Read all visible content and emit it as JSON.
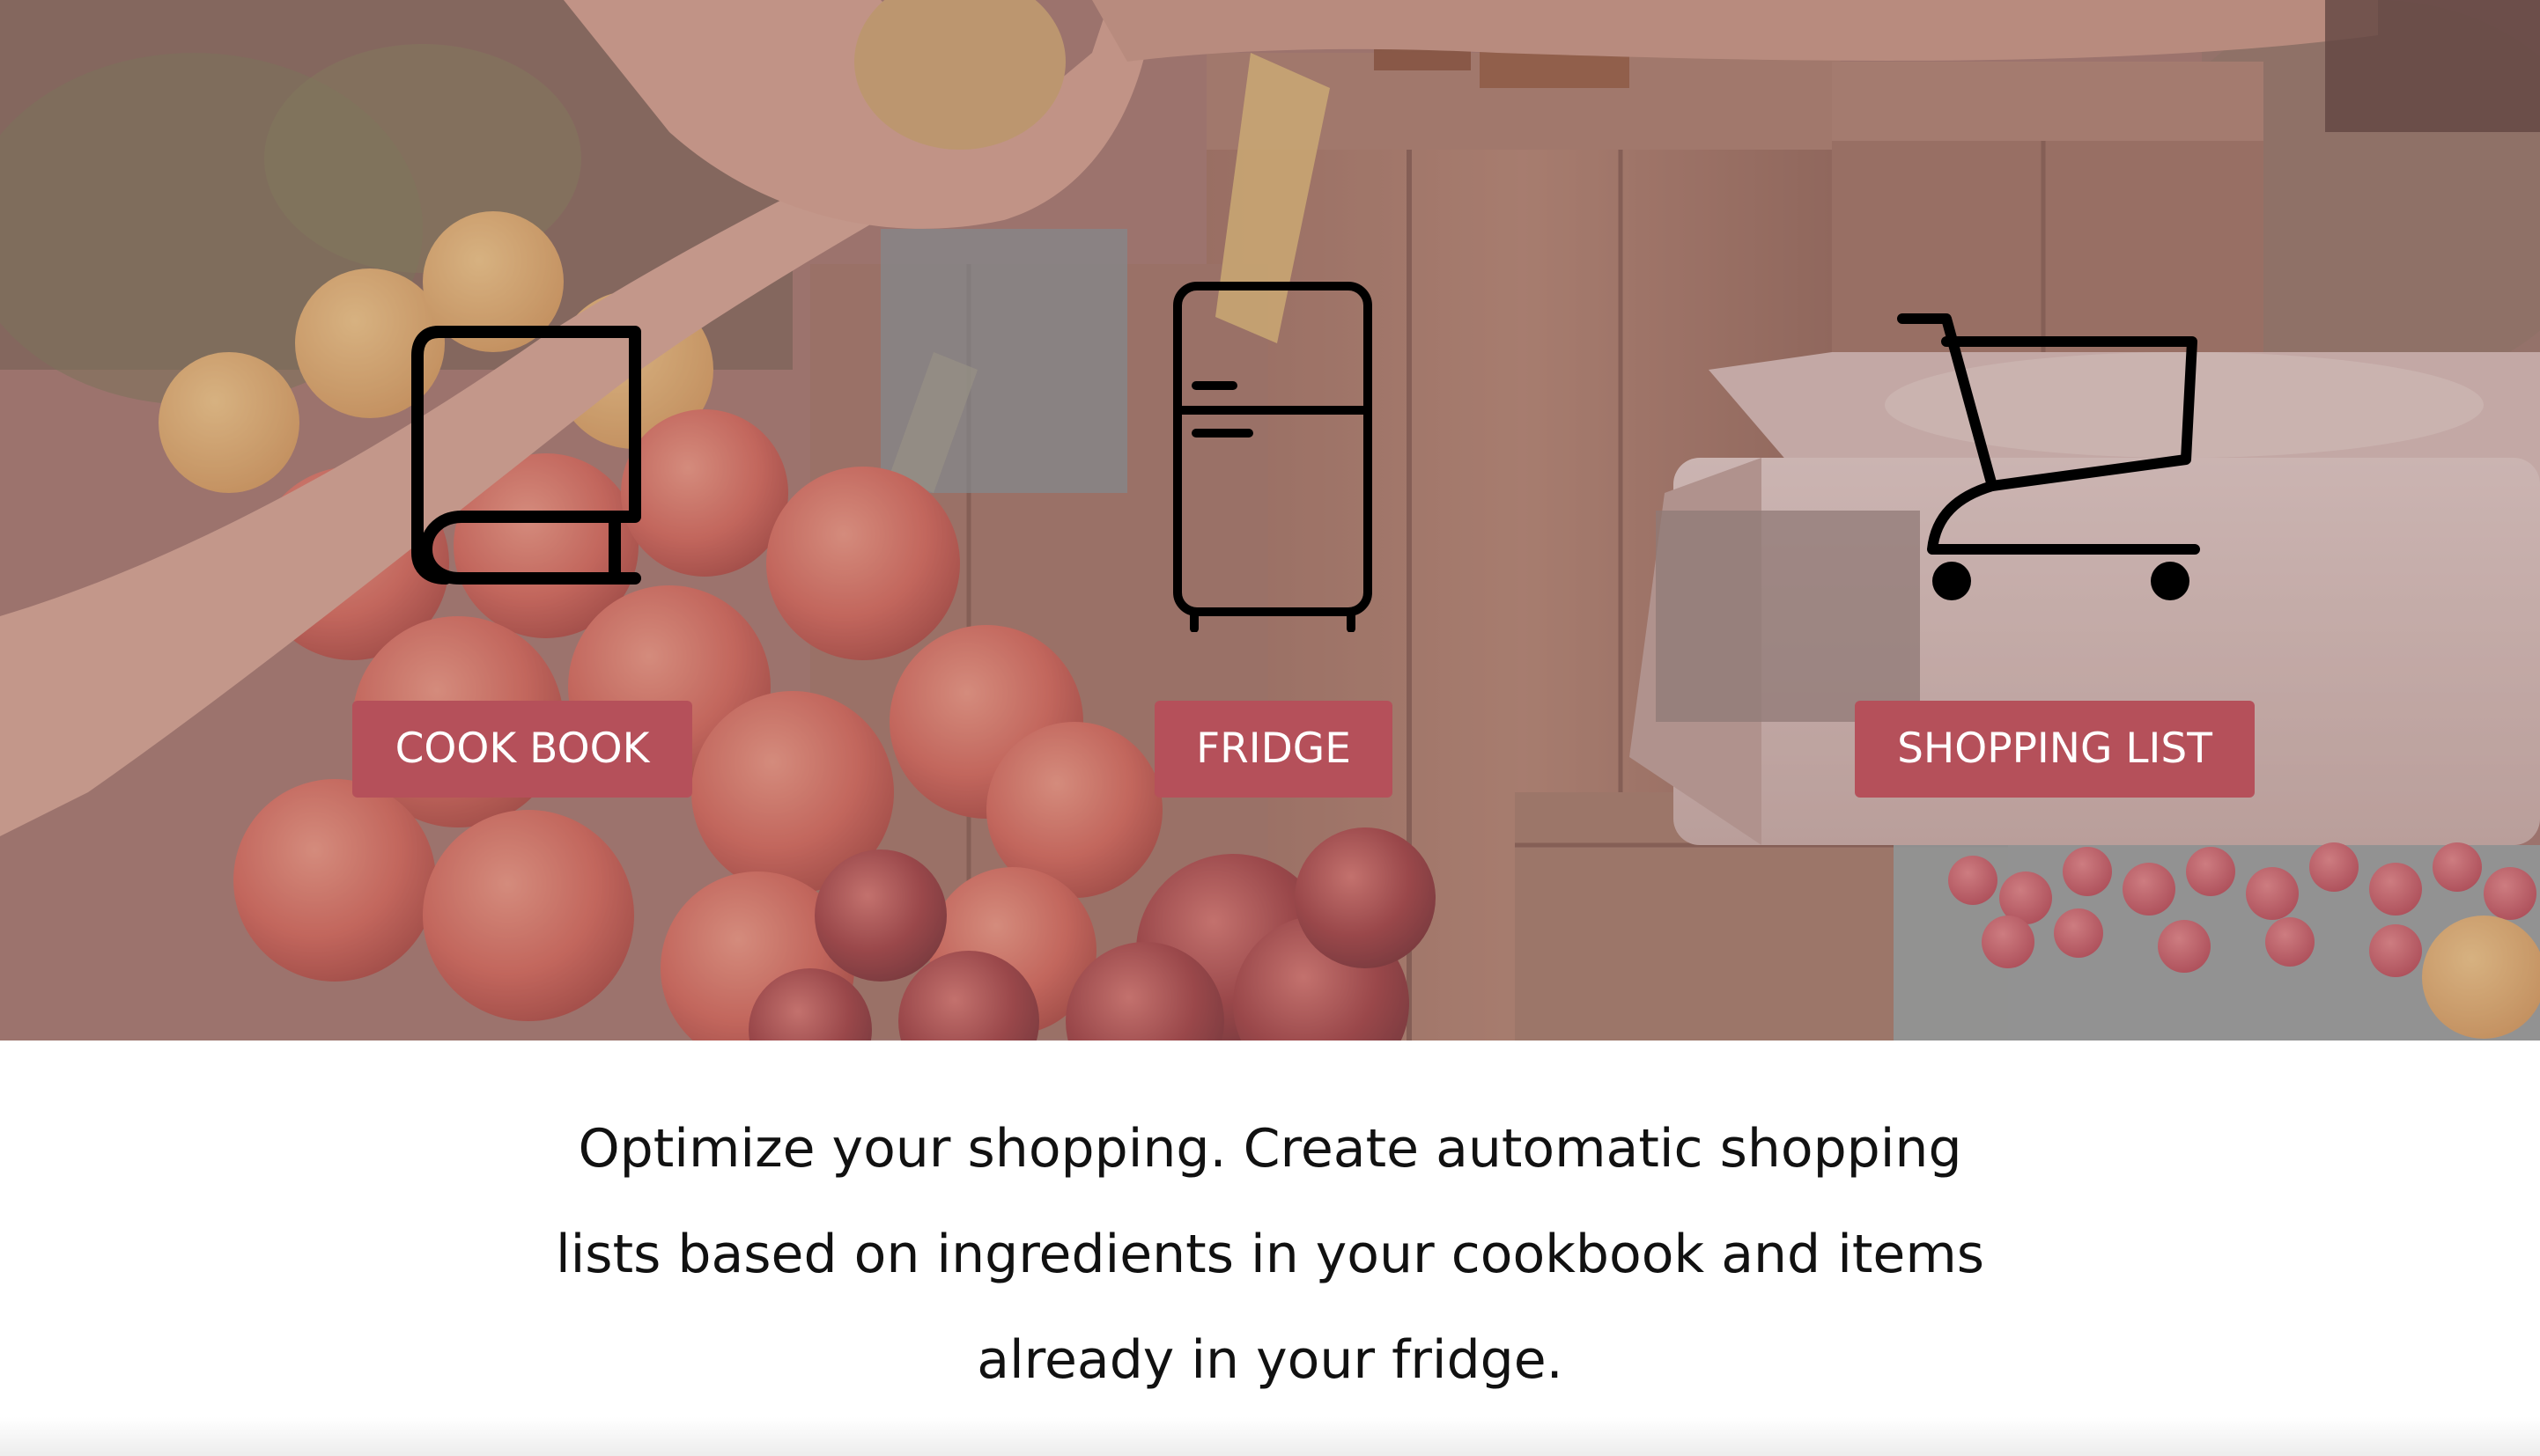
{
  "features": [
    {
      "icon": "book-icon",
      "label": "COOK BOOK"
    },
    {
      "icon": "fridge-icon",
      "label": "FRIDGE"
    },
    {
      "icon": "shopping-cart-icon",
      "label": "SHOPPING LIST"
    }
  ],
  "tagline": {
    "line1": "Optimize your shopping. Create automatic shopping",
    "line2": "lists based on ingredients in your cookbook and items",
    "line3": "already in your fridge."
  },
  "colors": {
    "button": "#b5505a",
    "button_text": "#ffffff",
    "icon_stroke": "#000000",
    "text": "#111111"
  }
}
